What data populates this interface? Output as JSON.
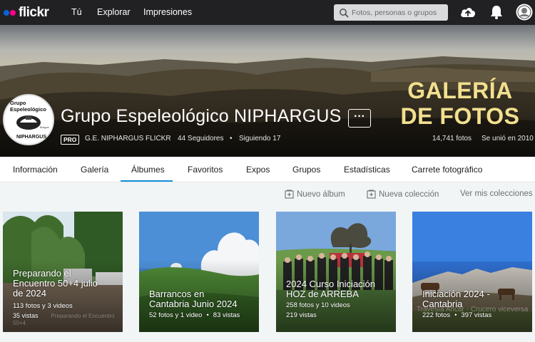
{
  "nav": {
    "logo": "flickr",
    "links": [
      "Tú",
      "Explorar",
      "Impresiones"
    ],
    "search_placeholder": "Fotos, personas o grupos",
    "icons": [
      "search-icon",
      "upload-cloud-icon",
      "bell-icon",
      "avatar"
    ]
  },
  "profile": {
    "name": "Grupo Espeleológico NIPHARGUS",
    "more_label": "···",
    "cover_text_line1": "GALERÍA",
    "cover_text_line2": "DE FOTOS",
    "pro_badge": "PRO",
    "screen_name": "G.E. NIPHARGUS FLICKR",
    "followers": "44 Seguidores",
    "following": "Siguiendo 17",
    "photos": "14,741 fotos",
    "joined": "Se unió en 2010",
    "avatar_top": "Grupo Espeleológico",
    "avatar_bottom": "NIPHARGUS",
    "avatar_mid": "Burgos"
  },
  "tabs": {
    "items": [
      "Información",
      "Galería",
      "Álbumes",
      "Favoritos",
      "Expos",
      "Grupos",
      "Estadísticas",
      "Carrete fotográfico"
    ],
    "active": "Álbumes"
  },
  "toolbar": {
    "new_album": "Nuevo álbum",
    "new_collection": "Nueva colección",
    "view_collections": "Ver mis colecciones"
  },
  "albums": [
    {
      "title_lines": [
        "Preparando el",
        "Encuentro 50+4 julio",
        "de 2024"
      ],
      "counts": "113 fotos y 3 videos",
      "views": "35 vistas",
      "watermark": "Preparando el Encuentro 50+4"
    },
    {
      "title_lines": [
        "Barrancos en",
        "Cantabria Junio 2024"
      ],
      "counts": "52 fotos y 1 video",
      "views": "83 vistas"
    },
    {
      "title_lines": [
        "2024 Curso Iniciación",
        "HOZ de ARREBA"
      ],
      "counts": "258 fotos y 10 videos",
      "views": "219 vistas"
    },
    {
      "title_lines": [
        "Iniciación 2024 -",
        "Cantabria"
      ],
      "counts": "222 fotos",
      "views": "397 vistas",
      "watermark": "Travesía Ancar - Crucero viceversa"
    }
  ],
  "colors": {
    "nav_bg": "#212124",
    "accent": "#128fdc",
    "flickr_blue": "#0a63dc",
    "flickr_pink": "#ff0084",
    "cover_text": "#f2e08f"
  }
}
